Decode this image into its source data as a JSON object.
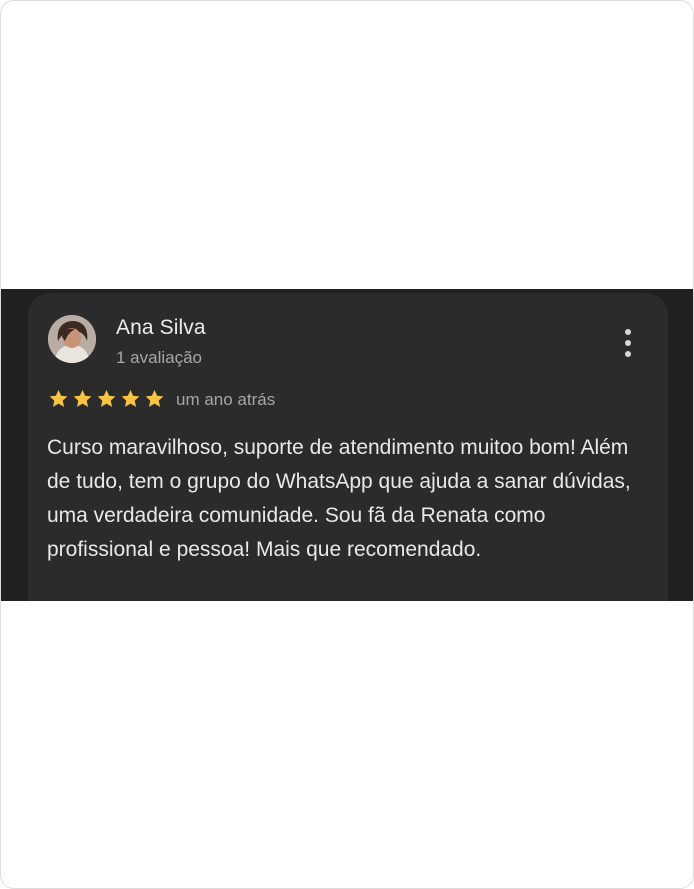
{
  "review": {
    "author_name": "Ana Silva",
    "author_meta": "1 avaliação",
    "rating": 5,
    "rating_max": 5,
    "time_ago": "um ano atrás",
    "text": "Curso maravilhoso, suporte de atendimento muitoo bom! Além de tudo, tem o grupo do WhatsApp que ajuda a sanar dúvidas, uma verdadeira comunidade. Sou fã da Renata como profissional e pessoa! Mais que recomendado.",
    "star_color": "#f6c343",
    "more_icon": "more-vert-icon"
  },
  "colors": {
    "page_background": "#ffffff",
    "strip_background": "#202020",
    "card_background": "#2b2b2b"
  }
}
